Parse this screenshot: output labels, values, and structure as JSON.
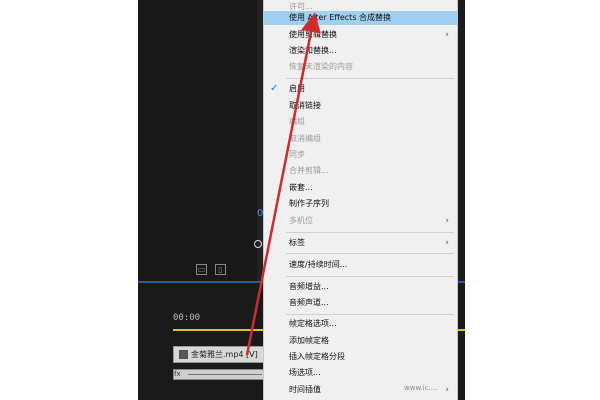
{
  "menu": {
    "items": [
      {
        "label": "许可...",
        "disabled": true
      },
      {
        "label": "使用 After Effects 合成替换",
        "highlight": true
      },
      {
        "label": "使用剪辑替换",
        "submenu": true
      },
      {
        "label": "渲染和替换..."
      },
      {
        "label": "恢复未渲染的内容",
        "disabled": true
      },
      {
        "label": "启用",
        "checked": true
      },
      {
        "label": "取消链接"
      },
      {
        "label": "编组",
        "disabled": true
      },
      {
        "label": "取消编组",
        "disabled": true
      },
      {
        "label": "同步",
        "disabled": true
      },
      {
        "label": "合并剪辑...",
        "disabled": true
      },
      {
        "label": "嵌套..."
      },
      {
        "label": "制作子序列"
      },
      {
        "label": "多机位",
        "disabled": true,
        "submenu": true
      },
      {
        "label": "标签",
        "submenu": true
      },
      {
        "label": "速度/持续时间..."
      },
      {
        "label": "音频增益..."
      },
      {
        "label": "音频声道..."
      },
      {
        "label": "帧定格选项..."
      },
      {
        "label": "添加帧定格"
      },
      {
        "label": "插入帧定格分段"
      },
      {
        "label": "场选项..."
      },
      {
        "label": "时间插值",
        "submenu": true
      }
    ]
  },
  "timeline": {
    "timecode": "00:00",
    "clip_label": "金菊雅兰.mp4 [V]"
  },
  "watermark": "www.ic....",
  "colors": {
    "highlight": "#9fd0f2",
    "arrow": "#d22a2a",
    "accent": "#2a5aa0"
  }
}
